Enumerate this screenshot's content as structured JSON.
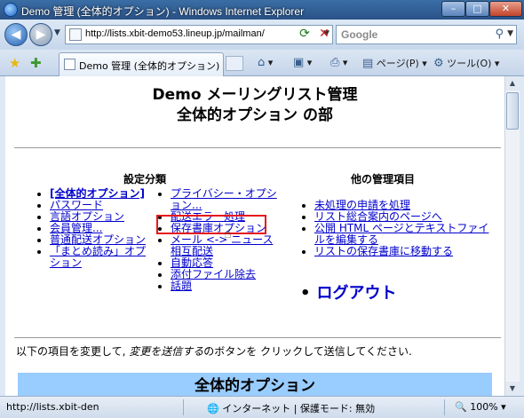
{
  "window": {
    "title": "Demo 管理 (全体的オプション) - Windows Internet Explorer",
    "min_glyph": "–",
    "max_glyph": "□",
    "close_glyph": "✕"
  },
  "nav": {
    "back_glyph": "◀",
    "forward_glyph": "▶",
    "address": "http://lists.xbit-demo53.lineup.jp/mailman/",
    "search_placeholder": "Google"
  },
  "tabs": [
    {
      "label": "Demo 管理 (全体的オプション)"
    }
  ],
  "commands": {
    "page_label": "ページ(P)",
    "tools_label": "ツール(O)"
  },
  "page": {
    "title_line1": "Demo メーリングリスト管理",
    "title_line2": "全体的オプション の部",
    "settings_heading": "設定分類",
    "other_heading": "他の管理項目",
    "col1": [
      "[全体的オプション]",
      "パスワード",
      "言語オプション",
      "会員管理...",
      "普通配送オプション",
      "「まとめ読み」オプション"
    ],
    "col2": [
      "プライバシー・オプション...",
      "配送エラー処理",
      "保存書庫オプション",
      "メール <-> ニュース相互配送",
      "自動応答",
      "添付ファイル除去",
      "話題"
    ],
    "col3": [
      "未処理の申請を処理",
      "リスト総合案内のページへ",
      "公開 HTML ページとテキストファイルを編集する",
      "リストの保存書庫に移動する"
    ],
    "logout": "ログアウト",
    "instruction_prefix": "以下の項目を変更して, ",
    "instruction_em": "変更を送信する",
    "instruction_suffix": "のボタンを クリックして送信してください.",
    "section_title": "全体的オプション"
  },
  "status": {
    "url": "http://lists.xbit-den",
    "zone": "インターネット | 保護モード: 無効",
    "zoom": "100%"
  },
  "colors": {
    "link": "#0000cc",
    "highlight_box": "#e6171c",
    "section_bar": "#99ccff"
  }
}
